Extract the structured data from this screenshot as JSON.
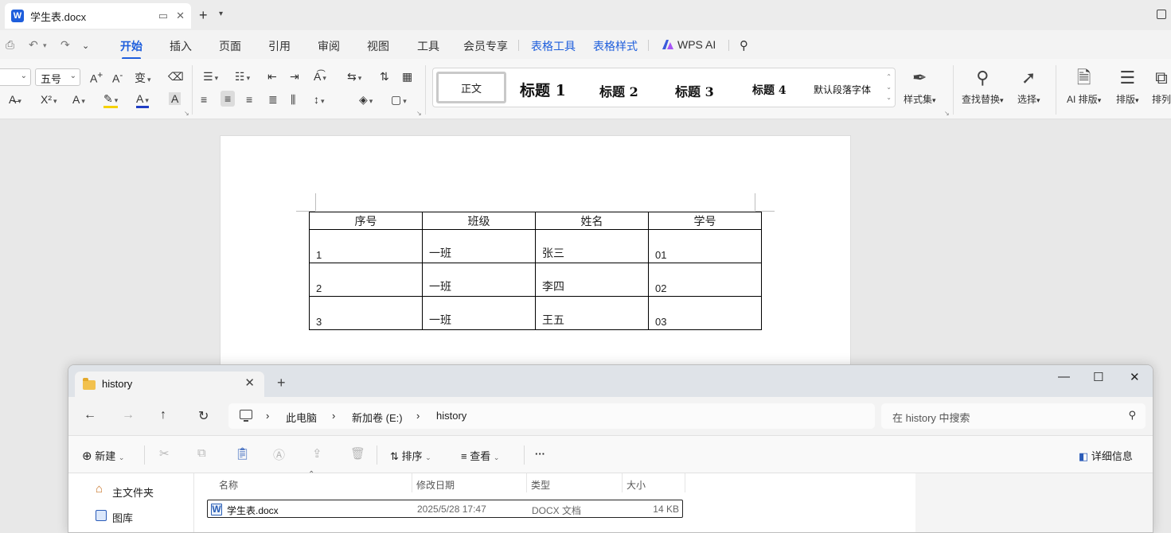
{
  "wps": {
    "doc_tab": {
      "logo": "W",
      "name": "学生表.docx"
    },
    "tabs": [
      {
        "id": "start",
        "label": "开始"
      },
      {
        "id": "insert",
        "label": "插入"
      },
      {
        "id": "page",
        "label": "页面"
      },
      {
        "id": "ref",
        "label": "引用"
      },
      {
        "id": "review",
        "label": "审阅"
      },
      {
        "id": "view",
        "label": "视图"
      },
      {
        "id": "tools",
        "label": "工具"
      },
      {
        "id": "vip",
        "label": "会员专享"
      },
      {
        "id": "table_tools",
        "label": "表格工具"
      },
      {
        "id": "table_style",
        "label": "表格样式"
      },
      {
        "id": "wpsai",
        "label": "WPS AI"
      }
    ],
    "toolbar": {
      "font_size": "五号",
      "styles": [
        "正文",
        "标题 1",
        "标题 2",
        "标题 3",
        "标题 4",
        "默认段落字体"
      ],
      "style_set": "样式集",
      "find_replace": "查找替换",
      "select": "选择",
      "ai_layout": "AI 排版",
      "layout": "排版",
      "arrange": "排列"
    }
  },
  "document": {
    "table": {
      "headers": [
        "序号",
        "班级",
        "姓名",
        "学号"
      ],
      "rows": [
        [
          "1",
          "一班",
          "张三",
          "01"
        ],
        [
          "2",
          "一班",
          "李四",
          "02"
        ],
        [
          "3",
          "一班",
          "王五",
          "03"
        ]
      ]
    }
  },
  "explorer": {
    "tab_title": "history",
    "breadcrumb": [
      "此电脑",
      "新加卷 (E:)",
      "history"
    ],
    "search_placeholder": "在 history 中搜索",
    "commands": {
      "new": "新建",
      "sort": "排序",
      "view": "查看",
      "more": "···",
      "details": "详细信息"
    },
    "sidebar": [
      "主文件夹",
      "图库"
    ],
    "columns": [
      "名称",
      "修改日期",
      "类型",
      "大小"
    ],
    "files": [
      {
        "name": "学生表.docx",
        "modified": "2025/5/28 17:47",
        "type": "DOCX 文档",
        "size": "14 KB"
      }
    ]
  }
}
